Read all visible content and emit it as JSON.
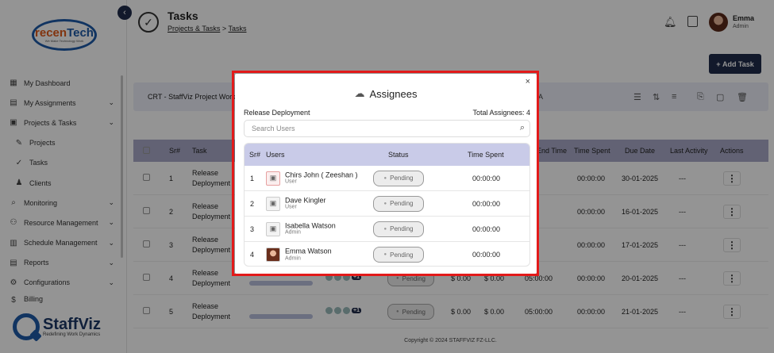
{
  "sidebar": {
    "logo_text_left": "recen",
    "logo_text_right": "Tech",
    "logo_tagline": "We Make Technology Work",
    "items": [
      {
        "label": "My Dashboard",
        "icon": "dashboard-icon",
        "chevron": false,
        "sub": false
      },
      {
        "label": "My Assignments",
        "icon": "clipboard-icon",
        "chevron": true,
        "sub": false
      },
      {
        "label": "Projects & Tasks",
        "icon": "calendar-icon",
        "chevron": true,
        "sub": false
      },
      {
        "label": "Projects",
        "icon": "edit-icon",
        "chevron": false,
        "sub": true
      },
      {
        "label": "Tasks",
        "icon": "check-circle-icon",
        "chevron": false,
        "sub": true
      },
      {
        "label": "Clients",
        "icon": "users-icon",
        "chevron": false,
        "sub": true
      },
      {
        "label": "Monitoring",
        "icon": "monitor-icon",
        "chevron": true,
        "sub": false
      },
      {
        "label": "Resource Management",
        "icon": "resource-icon",
        "chevron": true,
        "sub": false
      },
      {
        "label": "Schedule Management",
        "icon": "schedule-icon",
        "chevron": true,
        "sub": false
      },
      {
        "label": "Reports",
        "icon": "report-icon",
        "chevron": true,
        "sub": false
      },
      {
        "label": "Configurations",
        "icon": "gear-icon",
        "chevron": true,
        "sub": false
      },
      {
        "label": "Billing",
        "icon": "billing-icon",
        "chevron": false,
        "sub": false
      }
    ],
    "brand_name": "StaffViz",
    "brand_sub": "Redefining Work Dynamics"
  },
  "header": {
    "title": "Tasks",
    "breadcrumb_parent": "Projects & Tasks",
    "breadcrumb_sep": ">",
    "breadcrumb_current": "Tasks",
    "user_name": "Emma",
    "user_role": "Admin"
  },
  "main": {
    "add_task_label": "Add Task",
    "filter_project": "CRT - StaffViz Project Work",
    "filter_right": "A",
    "columns": [
      "Sr#",
      "Task",
      "End Time",
      "Time Spent",
      "Due Date",
      "Last Activity",
      "Actions"
    ],
    "rows": [
      {
        "sr": "1",
        "task": "Release Deployment",
        "end": "",
        "spent": "00:00:00",
        "due": "30-01-2025",
        "activity": "---"
      },
      {
        "sr": "2",
        "task": "Release Deployment",
        "end": "",
        "spent": "00:00:00",
        "due": "16-01-2025",
        "activity": "---"
      },
      {
        "sr": "3",
        "task": "Release Deployment",
        "end": "",
        "spent": "00:00:00",
        "due": "17-01-2025",
        "activity": "---"
      },
      {
        "sr": "4",
        "task": "Release Deployment",
        "end": "05:00:00",
        "spent": "00:00:00",
        "due": "20-01-2025",
        "activity": "---",
        "status": "Pending",
        "cost1": "$ 0.00",
        "cost2": "$ 0.00",
        "more": "+1"
      },
      {
        "sr": "5",
        "task": "Release Deployment",
        "end": "05:00:00",
        "spent": "00:00:00",
        "due": "21-01-2025",
        "activity": "---",
        "status": "Pending",
        "cost1": "$ 0.00",
        "cost2": "$ 0.00",
        "more": "+1"
      }
    ],
    "footer": "Copyright © 2024 STAFFVIZ FZ-LLC."
  },
  "modal": {
    "title": "Assignees",
    "task_name": "Release Deployment",
    "total_label": "Total Assignees: 4",
    "search_placeholder": "Search Users",
    "columns": {
      "sr": "Sr#",
      "users": "Users",
      "status": "Status",
      "time": "Time Spent"
    },
    "rows": [
      {
        "sr": "1",
        "name": "Chirs John ( Zeeshan )",
        "role": "User",
        "status": "Pending",
        "time": "00:00:00",
        "avatar": "placeholder-red"
      },
      {
        "sr": "2",
        "name": "Dave Kingler",
        "role": "User",
        "status": "Pending",
        "time": "00:00:00",
        "avatar": "placeholder"
      },
      {
        "sr": "3",
        "name": "Isabella Watson",
        "role": "Admin",
        "status": "Pending",
        "time": "00:00:00",
        "avatar": "placeholder-gray"
      },
      {
        "sr": "4",
        "name": "Emma Watson",
        "role": "Admin",
        "status": "Pending",
        "time": "00:00:00",
        "avatar": "photo"
      }
    ]
  },
  "colors": {
    "accent": "#1f2b4a",
    "highlight": "#e21a1a",
    "header_row": "#c9cbe8"
  }
}
